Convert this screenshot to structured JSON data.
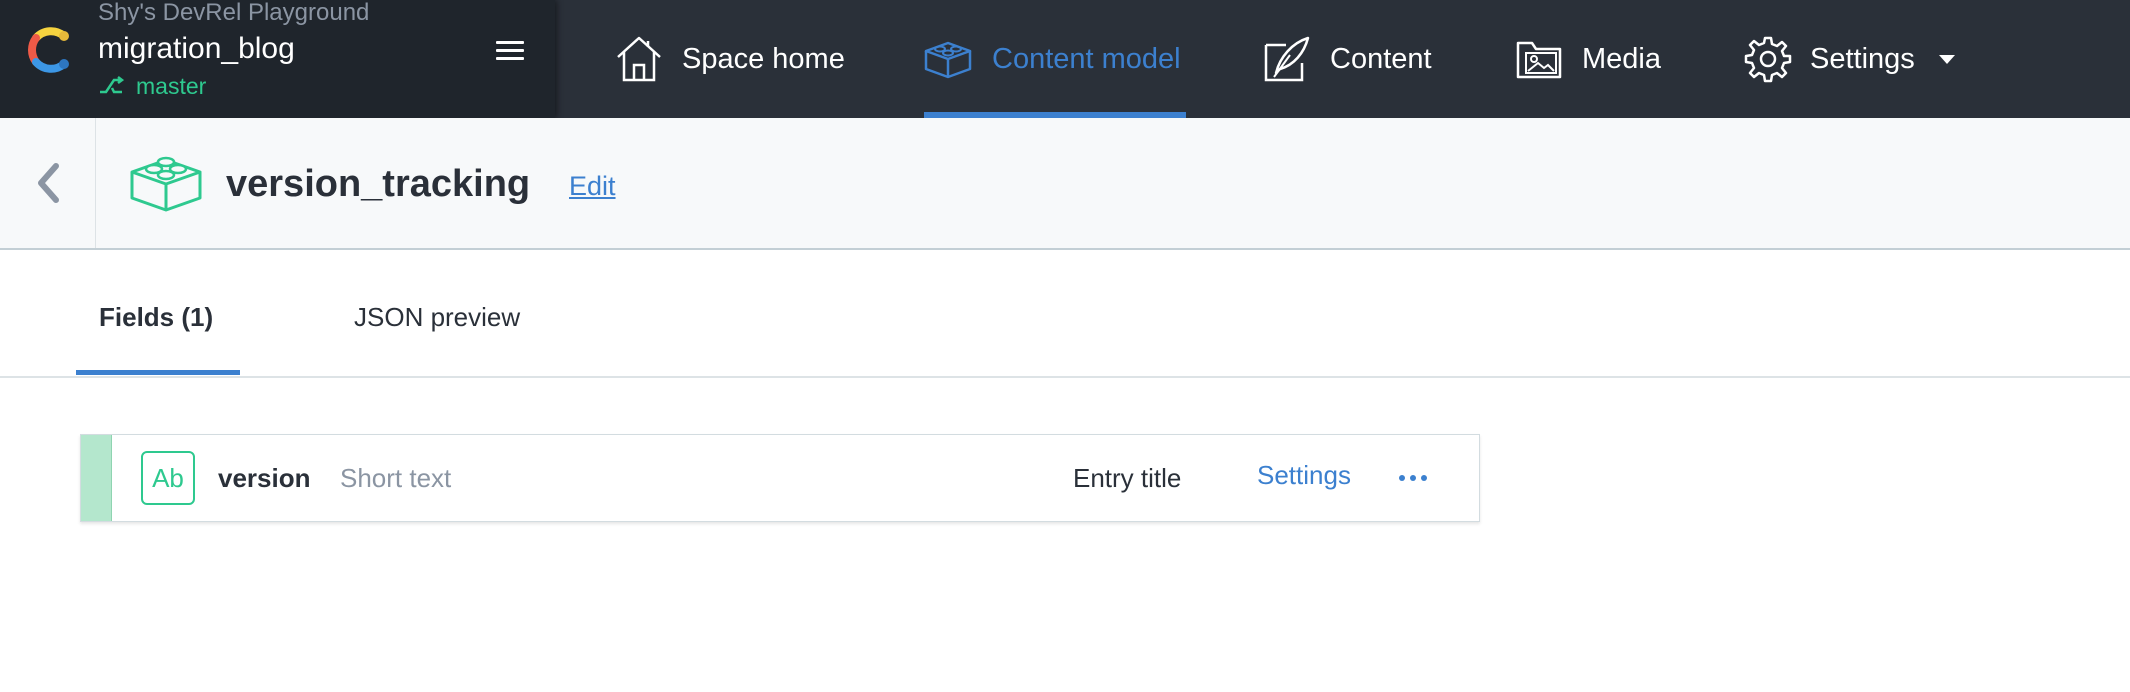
{
  "space": {
    "name": "Shy's DevRel Playground",
    "environment": "migration_blog",
    "branch": "master"
  },
  "nav": {
    "items": [
      {
        "label": "Space home",
        "icon": "home-icon"
      },
      {
        "label": "Content model",
        "icon": "content-model-icon",
        "active": true
      },
      {
        "label": "Content",
        "icon": "content-icon"
      },
      {
        "label": "Media",
        "icon": "media-icon"
      },
      {
        "label": "Settings",
        "icon": "gear-icon"
      }
    ]
  },
  "header": {
    "title": "version_tracking",
    "edit_label": "Edit"
  },
  "tabs": [
    {
      "label": "Fields (1)",
      "active": true
    },
    {
      "label": "JSON preview"
    }
  ],
  "fields": [
    {
      "type_icon": "Ab",
      "name": "version",
      "type": "Short text",
      "entry_title": "Entry title",
      "settings_label": "Settings"
    }
  ],
  "colors": {
    "accent": "#3c80cf",
    "green": "#2ec98f",
    "nav_bg": "#2a3039"
  }
}
